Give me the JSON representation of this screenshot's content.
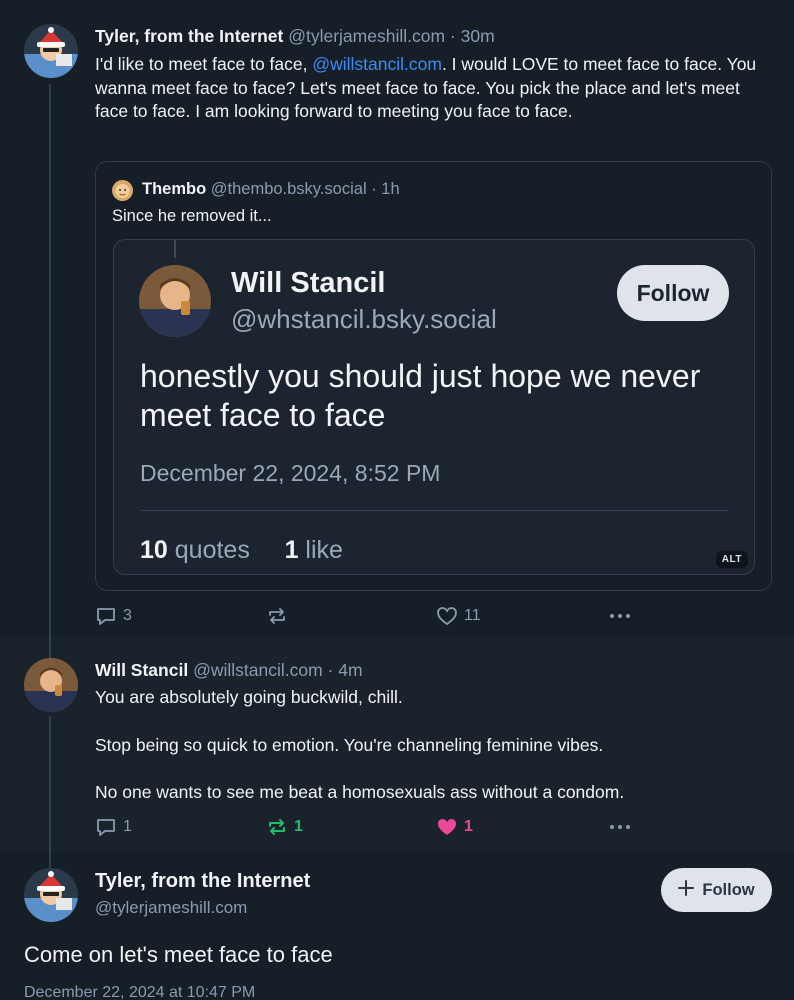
{
  "post1": {
    "author": "Tyler, from the Internet",
    "handle": "@tylerjameshill.com",
    "separator": "·",
    "time": "30m",
    "text_before": "I'd like to meet face to face, ",
    "mention": "@willstancil.com",
    "text_after": ". I would LOVE to meet face to face. You wanna meet face to face? Let's meet face to face. You pick the place and let's meet face to face. I am looking forward to meeting you face to face.",
    "quote": {
      "author": "Thembo",
      "handle": "@thembo.bsky.social",
      "separator": "·",
      "time": "1h",
      "text": "Since he removed it...",
      "screenshot": {
        "name": "Will Stancil",
        "handle": "@whstancil.bsky.social",
        "follow_label": "Follow",
        "text": "honestly you should just hope we never meet face to face",
        "date": "December 22, 2024, 8:52 PM",
        "quotes_count": "10",
        "quotes_label": "quotes",
        "likes_count": "1",
        "likes_label": "like",
        "alt_label": "ALT"
      }
    },
    "actions": {
      "replies": "3",
      "reposts": "",
      "likes": "11"
    }
  },
  "post2": {
    "author": "Will Stancil",
    "handle": "@willstancil.com",
    "separator": "·",
    "time": "4m",
    "paragraphs": [
      "You are absolutely going buckwild, chill.",
      "Stop being so quick to emotion. You're channeling feminine vibes.",
      "No one wants to see me beat a homosexuals ass without a condom."
    ],
    "actions": {
      "replies": "1",
      "reposts": "1",
      "likes": "1"
    }
  },
  "post3": {
    "author": "Tyler, from the Internet",
    "handle": "@tylerjameshill.com",
    "follow_label": "Follow",
    "text": "Come on let's meet face to face",
    "date": "December 22, 2024 at 10:47 PM"
  },
  "colors": {
    "background": "#161e27",
    "link": "#3b8cf5",
    "muted": "#8a9bb0",
    "repost_active": "#20bc6a",
    "like_active": "#ec4899"
  },
  "icons": [
    "reply-icon",
    "repost-icon",
    "like-icon",
    "more-icon",
    "plus-icon"
  ]
}
